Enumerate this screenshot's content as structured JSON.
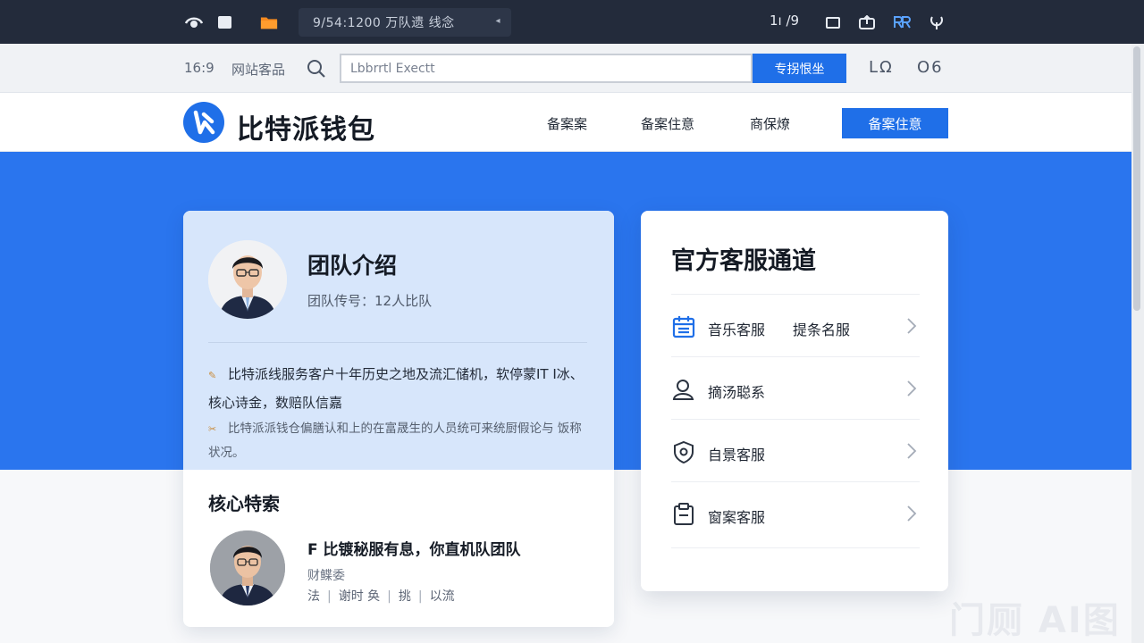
{
  "topbar": {
    "chip_text": "9/54:1200  万队遗  线念",
    "right_text": "1ı /9"
  },
  "addressbar": {
    "ratio": "16:9",
    "site_label": "网站客品",
    "search_value": "Lbbrrtl Exectt",
    "search_button": "专拐恨坐",
    "right_1": "LΩ",
    "right_2": "O6"
  },
  "header": {
    "brand": "比特派钱包",
    "nav": [
      "备案案",
      "备案住意",
      "商保燎"
    ],
    "cta": "备案住意"
  },
  "team": {
    "title": "团队介绍",
    "subtitle": "团队传号：12人比队",
    "desc1": "比特派线服务客户十年历史之地及流汇储机，软停蒙IT I冰、核心诗金，数赔队信嘉",
    "desc2": "比特派派钱仓偏膳认和上的在富晟生的人员统可来统厨假论与 饭称状况。",
    "core_title": "核心特索",
    "member": {
      "name": "F 比镀秘服有息，你直机队团队",
      "role": "财鲽委",
      "tags": [
        "法",
        "谢时 奂",
        "挑",
        "以流"
      ]
    }
  },
  "service": {
    "title": "官方客服通道",
    "items": [
      {
        "label": "音乐客服",
        "label2": "提条名服",
        "icon": "calendar-icon"
      },
      {
        "label": "摘汤聪系",
        "label2": "",
        "icon": "user-icon"
      },
      {
        "label": "自景客服",
        "label2": "",
        "icon": "shield-icon"
      },
      {
        "label": "窗案客服",
        "label2": "",
        "icon": "clipboard-icon"
      }
    ]
  },
  "watermark": "门厕 AI图",
  "colors": {
    "primary": "#1f6fe8",
    "hero": "#2a75ee",
    "topbar": "#232b3b",
    "team_card_top": "#d7e6fb"
  }
}
